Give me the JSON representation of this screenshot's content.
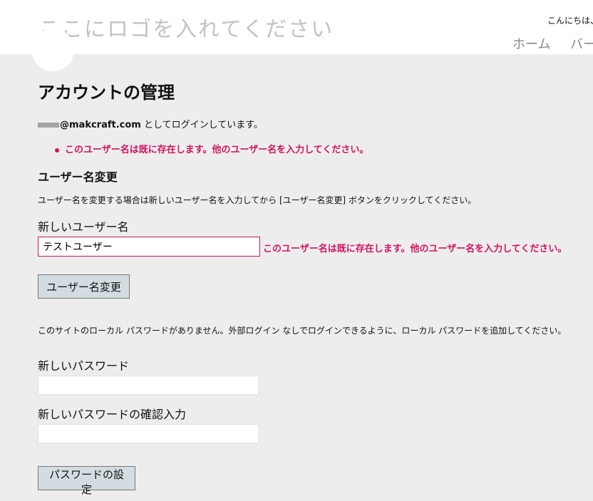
{
  "header": {
    "logo_text": "ここにロゴを入れてください",
    "greeting": "こんにちは、",
    "nav": [
      {
        "label": "ホーム"
      },
      {
        "label": "バー"
      }
    ]
  },
  "main": {
    "title": "アカウントの管理",
    "login_email_domain": "@makcraft.com",
    "login_suffix": " としてログインしています。",
    "error_summary": "このユーザー名は既に存在します。他のユーザー名を入力してください。",
    "username_section": {
      "title": "ユーザー名変更",
      "description": "ユーザー名を変更する場合は新しいユーザー名を入力してから [ユーザー名変更] ボタンをクリックしてください。",
      "field_label": "新しいユーザー名",
      "field_value": "テストユーザー",
      "field_error": "このユーザー名は既に存在します。他のユーザー名を入力してください。",
      "button_label": "ユーザー名変更"
    },
    "password_section": {
      "description": "このサイトのローカル パスワードがありません。外部ログイン なしでログインできるように、ローカル パスワードを追加してください。",
      "new_password_label": "新しいパスワード",
      "new_password_value": "",
      "confirm_label": "新しいパスワードの確認入力",
      "confirm_value": "",
      "button_label": "パスワードの設定"
    }
  },
  "colors": {
    "error": "#d0155f",
    "background": "#ededed",
    "header_background": "#ffffff",
    "button_background": "#d3dce0"
  }
}
